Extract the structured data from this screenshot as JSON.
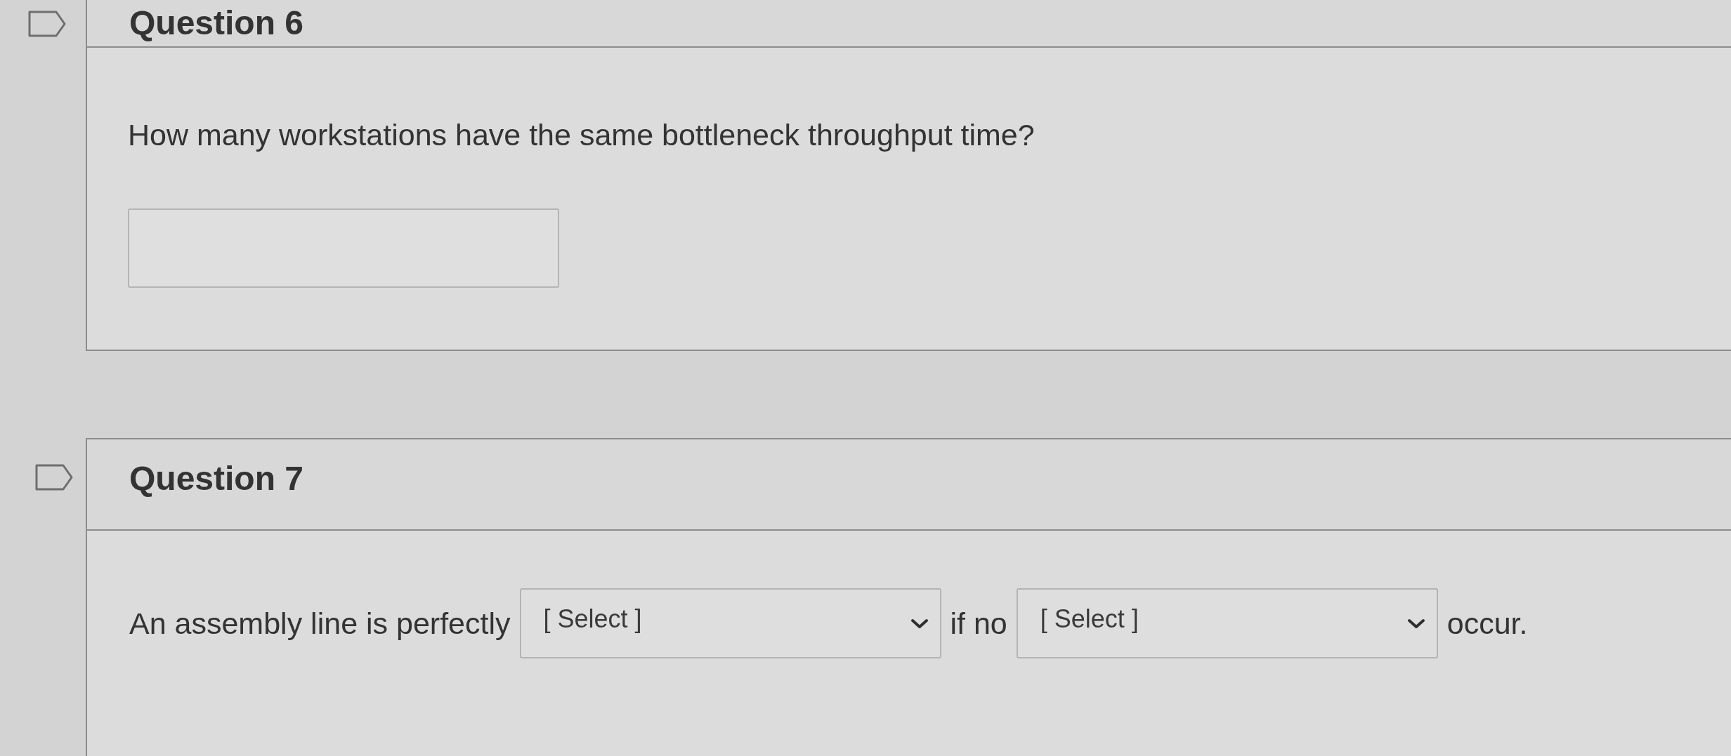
{
  "questions": [
    {
      "title": "Question 6",
      "flagged": false,
      "lines": [
        [
          {
            "kind": "text",
            "text": "How many workstations have the same bottleneck throughput time?"
          }
        ],
        [
          {
            "kind": "input"
          }
        ]
      ]
    },
    {
      "title": "Question 7",
      "flagged": false,
      "lines": [
        [
          {
            "kind": "text",
            "text": "An assembly line is perfectly"
          },
          {
            "kind": "select",
            "placeholder": "[ Select ]"
          },
          {
            "kind": "text",
            "text": "if no"
          },
          {
            "kind": "select",
            "placeholder": "[ Select ]"
          },
          {
            "kind": "text",
            "text": "occur."
          }
        ]
      ]
    }
  ]
}
